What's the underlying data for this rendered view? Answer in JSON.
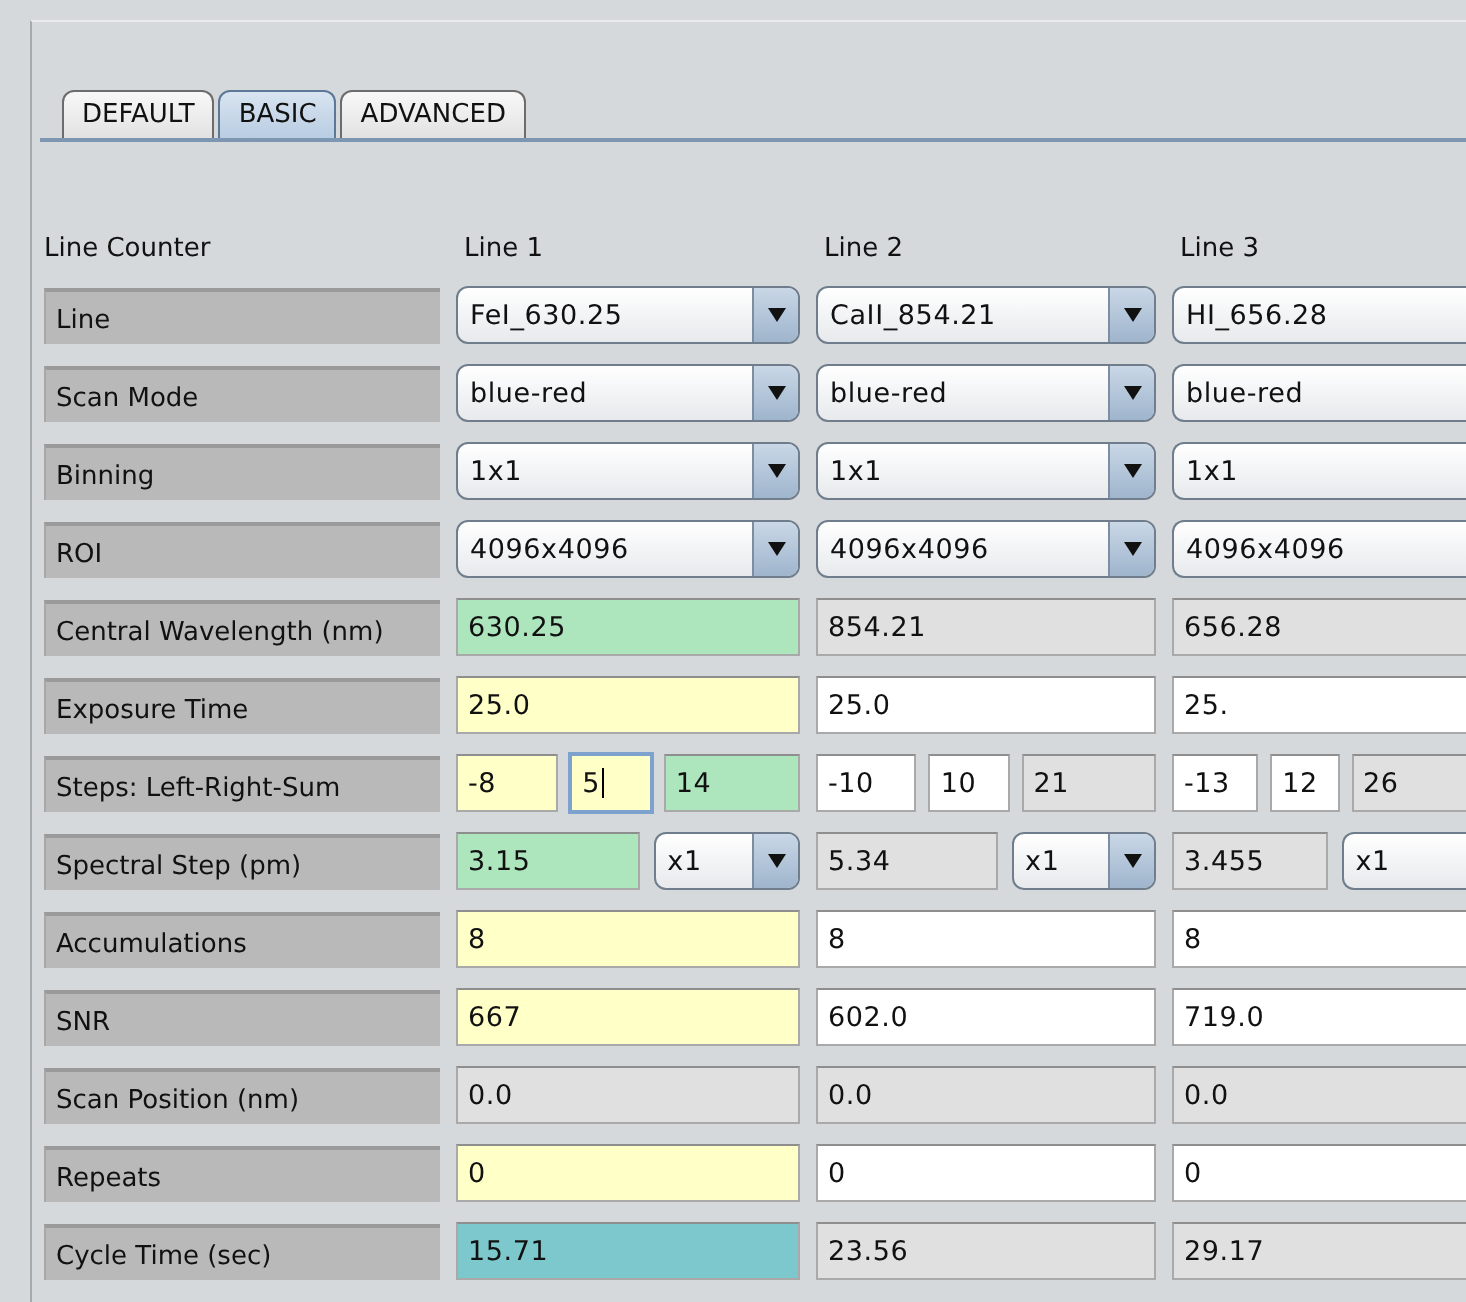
{
  "tabs": [
    {
      "label": "DEFAULT",
      "selected": false
    },
    {
      "label": "BASIC",
      "selected": true
    },
    {
      "label": "ADVANCED",
      "selected": false
    }
  ],
  "table": {
    "corner_label": "Line Counter",
    "columns": [
      {
        "title": "Line 1"
      },
      {
        "title": "Line 2"
      },
      {
        "title": "Line 3"
      }
    ],
    "rows": [
      {
        "label": "Line",
        "cells": [
          {
            "kind": "combo",
            "value": "FeI_630.25"
          },
          {
            "kind": "combo",
            "value": "CaII_854.21"
          },
          {
            "kind": "combo",
            "value": "HI_656.28"
          }
        ]
      },
      {
        "label": "Scan Mode",
        "cells": [
          {
            "kind": "combo",
            "value": "blue-red"
          },
          {
            "kind": "combo",
            "value": "blue-red"
          },
          {
            "kind": "combo",
            "value": "blue-red"
          }
        ]
      },
      {
        "label": "Binning",
        "cells": [
          {
            "kind": "combo",
            "value": "1x1"
          },
          {
            "kind": "combo",
            "value": "1x1"
          },
          {
            "kind": "combo",
            "value": "1x1"
          }
        ]
      },
      {
        "label": "ROI",
        "cells": [
          {
            "kind": "combo",
            "value": "4096x4096"
          },
          {
            "kind": "combo",
            "value": "4096x4096"
          },
          {
            "kind": "combo",
            "value": "4096x4096"
          }
        ]
      },
      {
        "label": "Central Wavelength (nm)",
        "cells": [
          {
            "kind": "field",
            "value": "630.25",
            "color": "#ade6bd"
          },
          {
            "kind": "field",
            "value": "854.21",
            "color": "#e0e0e0"
          },
          {
            "kind": "field",
            "value": "656.28",
            "color": "#e0e0e0"
          }
        ]
      },
      {
        "label": "Exposure Time",
        "cells": [
          {
            "kind": "field",
            "value": "25.0",
            "color": "#ffffc8"
          },
          {
            "kind": "field",
            "value": "25.0",
            "color": "#ffffff"
          },
          {
            "kind": "field",
            "value": "25.",
            "color": "#ffffff"
          }
        ]
      },
      {
        "label": "Steps: Left-Right-Sum",
        "cells": [
          {
            "kind": "triple",
            "parts": [
              {
                "value": "-8",
                "color": "#ffffc8",
                "focused": false
              },
              {
                "value": "5",
                "color": "#ffffc8",
                "focused": true
              },
              {
                "value": "14",
                "color": "#ade6bd",
                "focused": false
              }
            ]
          },
          {
            "kind": "triple",
            "parts": [
              {
                "value": "-10",
                "color": "#ffffff",
                "focused": false
              },
              {
                "value": "10",
                "color": "#ffffff",
                "focused": false
              },
              {
                "value": "21",
                "color": "#e0e0e0",
                "focused": false
              }
            ]
          },
          {
            "kind": "triple",
            "parts": [
              {
                "value": "-13",
                "color": "#ffffff",
                "focused": false
              },
              {
                "value": "12",
                "color": "#ffffff",
                "focused": false
              },
              {
                "value": "26",
                "color": "#e0e0e0",
                "focused": false
              }
            ]
          }
        ]
      },
      {
        "label": "Spectral Step (pm)",
        "cells": [
          {
            "kind": "step",
            "value": "3.15",
            "color": "#ade6bd",
            "factor": "x1"
          },
          {
            "kind": "step",
            "value": "5.34",
            "color": "#e0e0e0",
            "factor": "x1"
          },
          {
            "kind": "step",
            "value": "3.455",
            "color": "#e0e0e0",
            "factor": "x1"
          }
        ]
      },
      {
        "label": "Accumulations",
        "cells": [
          {
            "kind": "field",
            "value": "8",
            "color": "#ffffc8"
          },
          {
            "kind": "field",
            "value": "8",
            "color": "#ffffff"
          },
          {
            "kind": "field",
            "value": "8",
            "color": "#ffffff"
          }
        ]
      },
      {
        "label": "SNR",
        "cells": [
          {
            "kind": "field",
            "value": "667",
            "color": "#ffffc8"
          },
          {
            "kind": "field",
            "value": "602.0",
            "color": "#ffffff"
          },
          {
            "kind": "field",
            "value": "719.0",
            "color": "#ffffff"
          }
        ]
      },
      {
        "label": "Scan Position (nm)",
        "cells": [
          {
            "kind": "field",
            "value": "0.0",
            "color": "#e0e0e0"
          },
          {
            "kind": "field",
            "value": "0.0",
            "color": "#e0e0e0"
          },
          {
            "kind": "field",
            "value": "0.0",
            "color": "#e0e0e0"
          }
        ]
      },
      {
        "label": "Repeats",
        "cells": [
          {
            "kind": "field",
            "value": "0",
            "color": "#ffffc8"
          },
          {
            "kind": "field",
            "value": "0",
            "color": "#ffffff"
          },
          {
            "kind": "field",
            "value": "0",
            "color": "#ffffff"
          }
        ]
      },
      {
        "label": "Cycle Time (sec)",
        "cells": [
          {
            "kind": "field",
            "value": "15.71",
            "color": "#7cc8cc"
          },
          {
            "kind": "field",
            "value": "23.56",
            "color": "#e0e0e0"
          },
          {
            "kind": "field",
            "value": "29.17",
            "color": "#e0e0e0"
          }
        ]
      }
    ]
  }
}
